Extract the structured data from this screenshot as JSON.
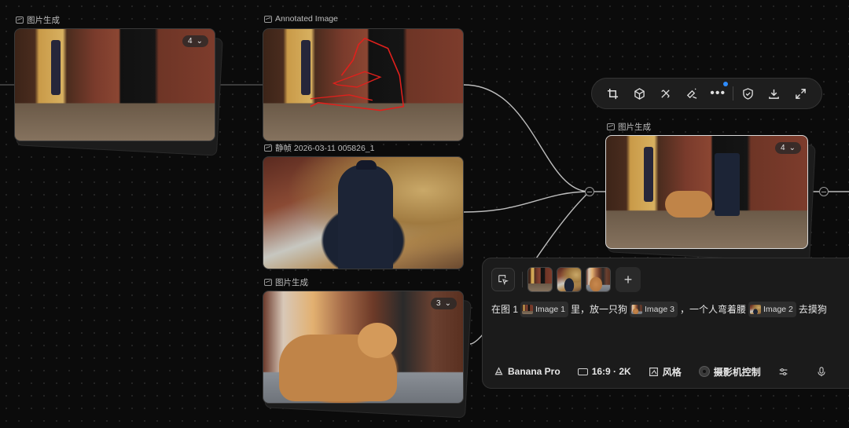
{
  "nodes": {
    "gen_left": {
      "label": "图片生成",
      "count": "4"
    },
    "annotated": {
      "label": "Annotated Image"
    },
    "still": {
      "label": "静帧 2026-03-11 005826_1"
    },
    "gen_dog": {
      "label": "图片生成",
      "count": "3"
    },
    "gen_right": {
      "label": "图片生成",
      "count": "4"
    }
  },
  "toolbar": {
    "icons": [
      "crop-icon",
      "cube-icon",
      "eraser-icon",
      "magic-eraser-icon",
      "more-icon",
      "shield-icon",
      "download-icon",
      "expand-icon"
    ]
  },
  "prompt_panel": {
    "text_parts": {
      "p1": "在图 1",
      "chip1": "Image 1",
      "p2": "里，放一只狗",
      "chip2": "Image 3",
      "p3": "，一个人弯着腰",
      "chip3": "Image 2",
      "p4": "去摸狗"
    },
    "model": "Banana Pro",
    "ratio": "16:9 · 2K",
    "style": "风格",
    "camera": "摄影机控制",
    "add_label": "+"
  },
  "colors": {
    "accent_dot": "#2f8cff",
    "annotation_red": "#e0201c",
    "background": "#0b0b0b"
  }
}
